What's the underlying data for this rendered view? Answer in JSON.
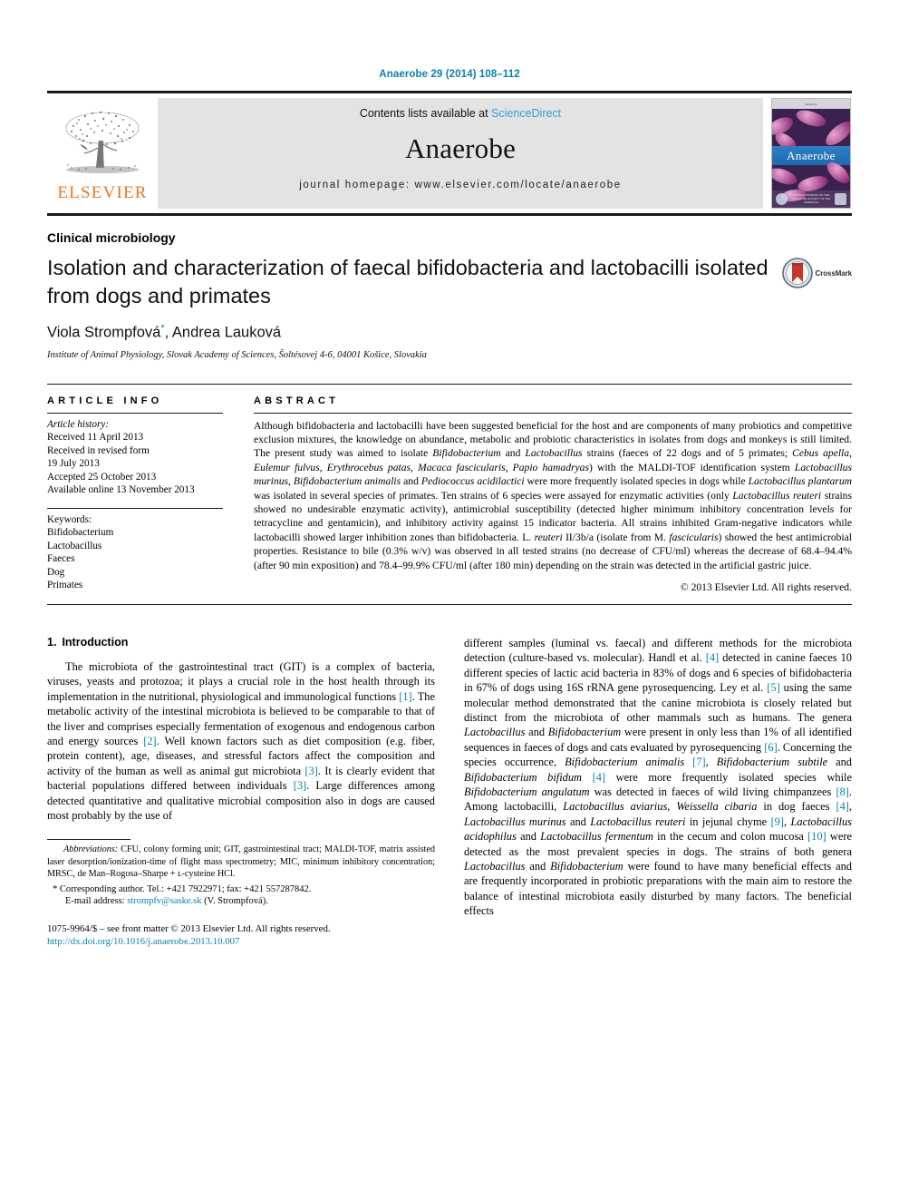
{
  "running_head": "Anaerobe 29 (2014) 108–112",
  "masthead": {
    "publisher_logo_label": "ELSEVIER",
    "contents_prefix": "Contents lists available at ",
    "contents_link": "ScienceDirect",
    "journal_name": "Anaerobe",
    "homepage": "journal homepage: www.elsevier.com/locate/anaerobe",
    "cover": {
      "title": "Anaerobe",
      "top_strip": "Anaerobe",
      "caption": "OFFICIAL JOURNAL OF THE ANAEROBE SOCIETY OF THE AMERICAS"
    }
  },
  "article": {
    "section_label": "Clinical microbiology",
    "title": "Isolation and characterization of faecal bifidobacteria and lactobacilli isolated from dogs and primates",
    "crossmark_label": "CrossMark",
    "authors": "Viola Strompfová",
    "authors_star": "*",
    "authors_rest": ", Andrea Lauková",
    "affiliation": "Institute of Animal Physiology, Slovak Academy of Sciences, Šoltésovej 4-6, 04001 Košice, Slovakia"
  },
  "article_info": {
    "heading": "ARTICLE INFO",
    "history_label": "Article history:",
    "history": [
      "Received 11 April 2013",
      "Received in revised form",
      "19 July 2013",
      "Accepted 25 October 2013",
      "Available online 13 November 2013"
    ],
    "keywords_label": "Keywords:",
    "keywords": [
      "Bifidobacterium",
      "Lactobacillus",
      "Faeces",
      "Dog",
      "Primates"
    ],
    "keywords_italic_index": 1
  },
  "abstract": {
    "heading": "ABSTRACT",
    "text": "Although bifidobacteria and lactobacilli have been suggested beneficial for the host and are components of many probiotics and competitive exclusion mixtures, the knowledge on abundance, metabolic and probiotic characteristics in isolates from dogs and monkeys is still limited. The present study was aimed to isolate Bifidobacterium and Lactobacillus strains (faeces of 22 dogs and of 5 primates; Cebus apella, Eulemur fulvus, Erythrocebus patas, Macaca fascicularis, Papio hamadryas) with the MALDI-TOF identification system Lactobacillus murinus, Bifidobacterium animalis and Pediococcus acidilactici were more frequently isolated species in dogs while Lactobacillus plantarum was isolated in several species of primates. Ten strains of 6 species were assayed for enzymatic activities (only Lactobacillus reuteri strains showed no undesirable enzymatic activity), antimicrobial susceptibility (detected higher minimum inhibitory concentration levels for tetracycline and gentamicin), and inhibitory activity against 15 indicator bacteria. All strains inhibited Gram-negative indicators while lactobacilli showed larger inhibition zones than bifidobacteria. L. reuteri II/3b/a (isolate from M. fascicularis) showed the best antimicrobial properties. Resistance to bile (0.3% w/v) was observed in all tested strains (no decrease of CFU/ml) whereas the decrease of 68.4–94.4% (after 90 min exposition) and 78.4–99.9% CFU/ml (after 180 min) depending on the strain was detected in the artificial gastric juice.",
    "copyright": "© 2013 Elsevier Ltd. All rights reserved."
  },
  "introduction": {
    "number": "1.",
    "heading": "Introduction",
    "left_paragraph_1": "The microbiota of the gastrointestinal tract (GIT) is a complex of bacteria, viruses, yeasts and protozoa; it plays a crucial role in the host health through its implementation in the nutritional, physiological and immunological functions [1]. The metabolic activity of the intestinal microbiota is believed to be comparable to that of the liver and comprises especially fermentation of exogenous and endogenous carbon and energy sources [2]. Well known factors such as diet composition (e.g. fiber, protein content), age, diseases, and stressful factors affect the composition and activity of the human as well as animal gut microbiota [3]. It is clearly evident that bacterial populations differed between individuals [3]. Large differences among detected quantitative and qualitative microbial composition also in dogs are caused most probably by the use of",
    "right_paragraph_1": "different samples (luminal vs. faecal) and different methods for the microbiota detection (culture-based vs. molecular). Handl et al. [4] detected in canine faeces 10 different species of lactic acid bacteria in 83% of dogs and 6 species of bifidobacteria in 67% of dogs using 16S rRNA gene pyrosequencing. Ley et al. [5] using the same molecular method demonstrated that the canine microbiota is closely related but distinct from the microbiota of other mammals such as humans. The genera Lactobacillus and Bifidobacterium were present in only less than 1% of all identified sequences in faeces of dogs and cats evaluated by pyrosequencing [6]. Concerning the species occurrence, Bifidobacterium animalis [7], Bifidobacterium subtile and Bifidobacterium bifidum [4] were more frequently isolated species while Bifidobacterium angulatum was detected in faeces of wild living chimpanzees [8]. Among lactobacilli, Lactobacillus aviarius, Weissella cibaria in dog faeces [4], Lactobacillus murinus and Lactobacillus reuteri in jejunal chyme [9], Lactobacillus acidophilus and Lactobacillus fermentum in the cecum and colon mucosa [10] were detected as the most prevalent species in dogs. The strains of both genera Lactobacillus and Bifidobacterium were found to have many beneficial effects and are frequently incorporated in probiotic preparations with the main aim to restore the balance of intestinal microbiota easily disturbed by many factors. The beneficial effects"
  },
  "footnotes": {
    "abbreviations_label": "Abbreviations:",
    "abbreviations_text": " CFU, colony forming unit; GIT, gastrointestinal tract; MALDI-TOF, matrix assisted laser desorption/ionization-time of flight mass spectrometry; MIC, minimum inhibitory concentration; MRSC, de Man–Rogosa–Sharpe + ʟ-cysteine HCl.",
    "corresponding": "* Corresponding author. Tel.: +421 7922971; fax: +421 557287842.",
    "email_label": "E-mail address:",
    "email": "strompfv@saske.sk",
    "email_suffix": " (V. Strompfová).",
    "imprint": "1075-9964/$ – see front matter © 2013 Elsevier Ltd. All rights reserved.",
    "doi": "http://dx.doi.org/10.1016/j.anaerobe.2013.10.007"
  }
}
